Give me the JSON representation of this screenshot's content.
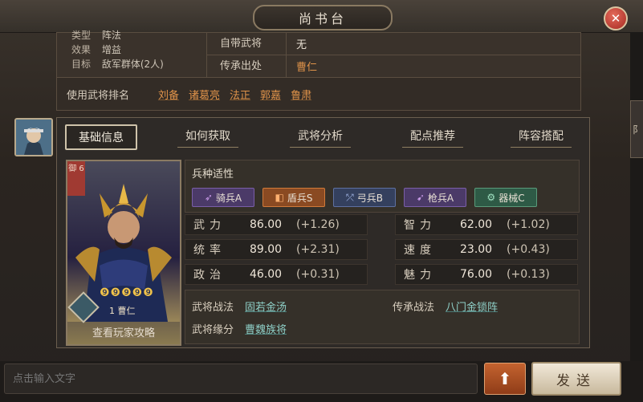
{
  "window": {
    "title": "尚书台",
    "close_label": "✕"
  },
  "top_left": {
    "partial_row": {
      "key": "类型",
      "value": "阵法"
    },
    "effect": {
      "key": "效果",
      "value": "增益"
    },
    "target": {
      "key": "目标",
      "value": "敌军群体(2人)"
    }
  },
  "top_right": {
    "self_general": {
      "key": "自带武将",
      "value": "无"
    },
    "inherit_source": {
      "key": "传承出处",
      "value": "曹仁"
    }
  },
  "usage": {
    "label": "使用武将排名",
    "names": [
      "刘备",
      "诸葛亮",
      "法正",
      "郭嘉",
      "鲁肃"
    ]
  },
  "tabs": [
    "基础信息",
    "如何获取",
    "武将分析",
    "配点推荐",
    "阵容搭配"
  ],
  "active_tab": "基础信息",
  "card": {
    "side_badge": "御 6",
    "stars": "❾❾❾❾❾",
    "name": "1 曹仁",
    "link_label": "查看玩家攻略"
  },
  "aptitude": {
    "title": "兵种适性",
    "chips": [
      {
        "label": "骑兵A",
        "color": "#7a4e9c"
      },
      {
        "label": "盾兵S",
        "color": "#c0622a"
      },
      {
        "label": "弓兵B",
        "color": "#4b5f96"
      },
      {
        "label": "枪兵A",
        "color": "#7a4e9c"
      },
      {
        "label": "器械C",
        "color": "#3f7a5a"
      }
    ]
  },
  "stats": {
    "force": {
      "label": "武力",
      "value": "86.00",
      "bonus": "(+1.26)"
    },
    "intel": {
      "label": "智力",
      "value": "62.00",
      "bonus": "(+1.02)"
    },
    "command": {
      "label": "统率",
      "value": "89.00",
      "bonus": "(+2.31)"
    },
    "speed": {
      "label": "速度",
      "value": "23.00",
      "bonus": "(+0.43)"
    },
    "politics": {
      "label": "政治",
      "value": "46.00",
      "bonus": "(+0.31)"
    },
    "charm": {
      "label": "魅力",
      "value": "76.00",
      "bonus": "(+0.13)"
    }
  },
  "skills": {
    "tactic": {
      "label": "武将战法",
      "value": "固若金汤"
    },
    "inherit": {
      "label": "传承战法",
      "value": "八门金锁阵"
    },
    "fate": {
      "label": "武将缘分",
      "value": "曹魏族将"
    }
  },
  "chat": {
    "placeholder": "点击输入文字",
    "send_label": "发送",
    "up_label": "⬆"
  }
}
